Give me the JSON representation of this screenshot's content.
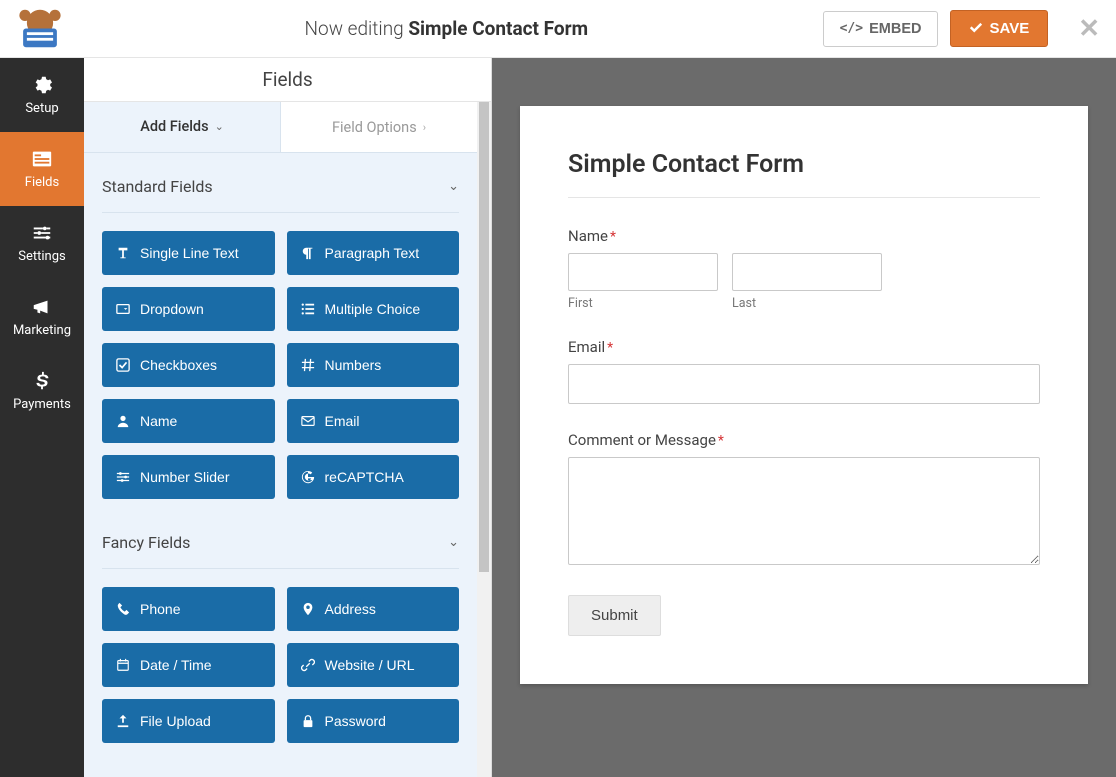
{
  "topbar": {
    "editing_prefix": "Now editing ",
    "form_name": "Simple Contact Form",
    "embed_label": "EMBED",
    "save_label": "SAVE"
  },
  "iconbar": {
    "setup": "Setup",
    "fields": "Fields",
    "settings": "Settings",
    "marketing": "Marketing",
    "payments": "Payments"
  },
  "panel": {
    "header": "Fields",
    "tab_add": "Add Fields",
    "tab_options": "Field Options",
    "standard_title": "Standard Fields",
    "fancy_title": "Fancy Fields",
    "standard": [
      {
        "label": "Single Line Text",
        "icon": "text"
      },
      {
        "label": "Paragraph Text",
        "icon": "paragraph"
      },
      {
        "label": "Dropdown",
        "icon": "dropdown"
      },
      {
        "label": "Multiple Choice",
        "icon": "list"
      },
      {
        "label": "Checkboxes",
        "icon": "check"
      },
      {
        "label": "Numbers",
        "icon": "hash"
      },
      {
        "label": "Name",
        "icon": "user"
      },
      {
        "label": "Email",
        "icon": "envelope"
      },
      {
        "label": "Number Slider",
        "icon": "sliders"
      },
      {
        "label": "reCAPTCHA",
        "icon": "google"
      }
    ],
    "fancy": [
      {
        "label": "Phone",
        "icon": "phone"
      },
      {
        "label": "Address",
        "icon": "pin"
      },
      {
        "label": "Date / Time",
        "icon": "calendar"
      },
      {
        "label": "Website / URL",
        "icon": "link"
      },
      {
        "label": "File Upload",
        "icon": "upload"
      },
      {
        "label": "Password",
        "icon": "lock"
      }
    ]
  },
  "form": {
    "title": "Simple Contact Form",
    "name_label": "Name",
    "first_label": "First",
    "last_label": "Last",
    "email_label": "Email",
    "comment_label": "Comment or Message",
    "submit_label": "Submit"
  }
}
